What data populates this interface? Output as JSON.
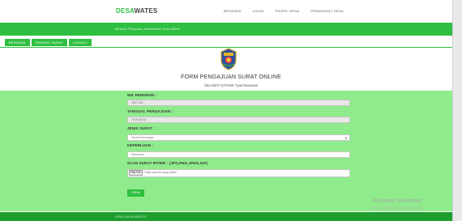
{
  "header": {
    "brand_prefix": "DESA",
    "brand_suffix": "WATES",
    "nav": [
      "BERANDA",
      "LOGIN",
      "PROFIL DESA",
      "PERANGKAT DESA"
    ]
  },
  "banner": {
    "text": "Website Pelayanan Administrasi Desa Wates"
  },
  "actions": {
    "buttons": [
      "BERANDA",
      "RIWAYAT SURAT",
      "LOGOUT"
    ]
  },
  "form": {
    "title": "FORM PENGAJUAN SURAT ONLINE",
    "greeting": "SELAMAT DATANG Tyas Ratnasari",
    "fields": {
      "nik": {
        "label": "NIK PEMOHON :",
        "value": "3507128..."
      },
      "tanggal": {
        "label": "TANGGAL PENGAJUAN :",
        "value": "2019-08-04"
      },
      "jenis": {
        "label": "JENIS SURAT :",
        "value": "Surat Keterangan"
      },
      "keperluan": {
        "label": "KEPERLUAN :",
        "placeholder": "Keperluan"
      },
      "scan": {
        "label": "SCAN SURAT RT/RW : (JPG,PNG,JPEG,GIF)",
        "button": "Pilih File",
        "status": "Tidak ada file yang dipilih"
      }
    },
    "submit_label": "KIRIM"
  },
  "footer": {
    "text": "SIPAS DESA WATES"
  },
  "watermark": {
    "title": "Activate Windows",
    "subtitle": "Go to Settings to activate Windows."
  },
  "colors": {
    "green": "#2fbf40",
    "panel": "#8feb8c",
    "footer": "#1e9e2e"
  }
}
